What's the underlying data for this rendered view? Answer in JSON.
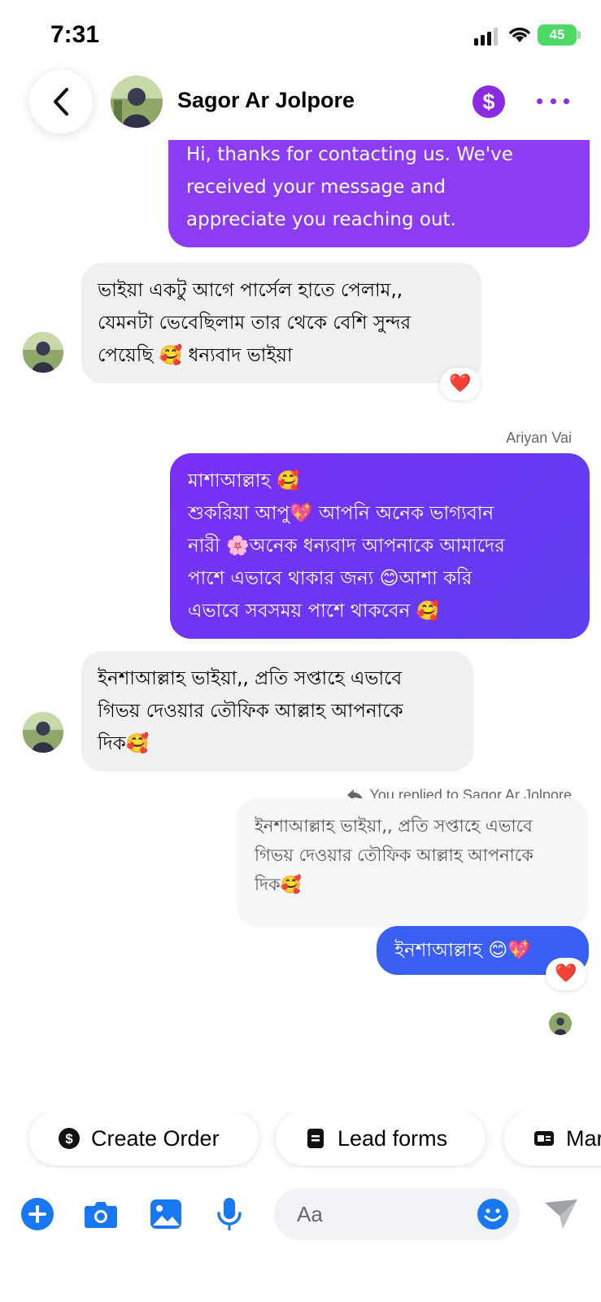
{
  "status_bar": {
    "time": "7:31",
    "battery": "45"
  },
  "header": {
    "contact_name": "Sagor Ar Jolpore",
    "payment_symbol": "$"
  },
  "messages": {
    "m1": {
      "text": "Hi, thanks for contacting us. We've\nreceived your message and\nappreciate you reaching out."
    },
    "m2": {
      "text": "ভাইয়া একটু আগে পার্সেল হাতে পেলাম,,\nযেমনটা ভেবেছিলাম তার থেকে বেশি সুন্দর\nপেয়েছি 🥰 ধন্যবাদ ভাইয়া",
      "reaction": "❤️"
    },
    "m3": {
      "sender": "Ariyan Vai",
      "text": "মাশাআল্লাহ 🥰\nশুকরিয়া আপু💖 আপনি অনেক ভাগ্যবান\nনারী 🌸অনেক ধন্যবাদ আপনাকে আমাদের\nপাশে এভাবে থাকার জন্য 😊আশা করি\nএভাবে সবসময়  পাশে থাকবেন 🥰"
    },
    "m4": {
      "text": "ইনশাআল্লাহ ভাইয়া,, প্রতি সপ্তাহে এভাবে\nগিভয় দেওয়ার তৌফিক আল্লাহ আপনাকে\nদিক🥰"
    },
    "reply_label": "You replied to Sagor Ar Jolpore",
    "m5_quoted": {
      "text": "ইনশাআল্লাহ ভাইয়া,, প্রতি সপ্তাহে এভাবে\nগিভয় দেওয়ার তৌফিক আল্লাহ আপনাকে\nদিক🥰"
    },
    "m6": {
      "text": "ইনশাআল্লাহ 😊💖",
      "reaction": "❤️"
    }
  },
  "quick_actions": [
    {
      "label": "Create Order",
      "icon": "dollar-circle-icon"
    },
    {
      "label": "Lead forms",
      "icon": "form-icon"
    },
    {
      "label": "Mar",
      "icon": "card-icon"
    }
  ],
  "composer": {
    "placeholder": "Aa"
  },
  "colors": {
    "accent_purple": "#8a2be2",
    "bubble_blue": "#3a5ff2",
    "icon_blue": "#1877f2"
  }
}
